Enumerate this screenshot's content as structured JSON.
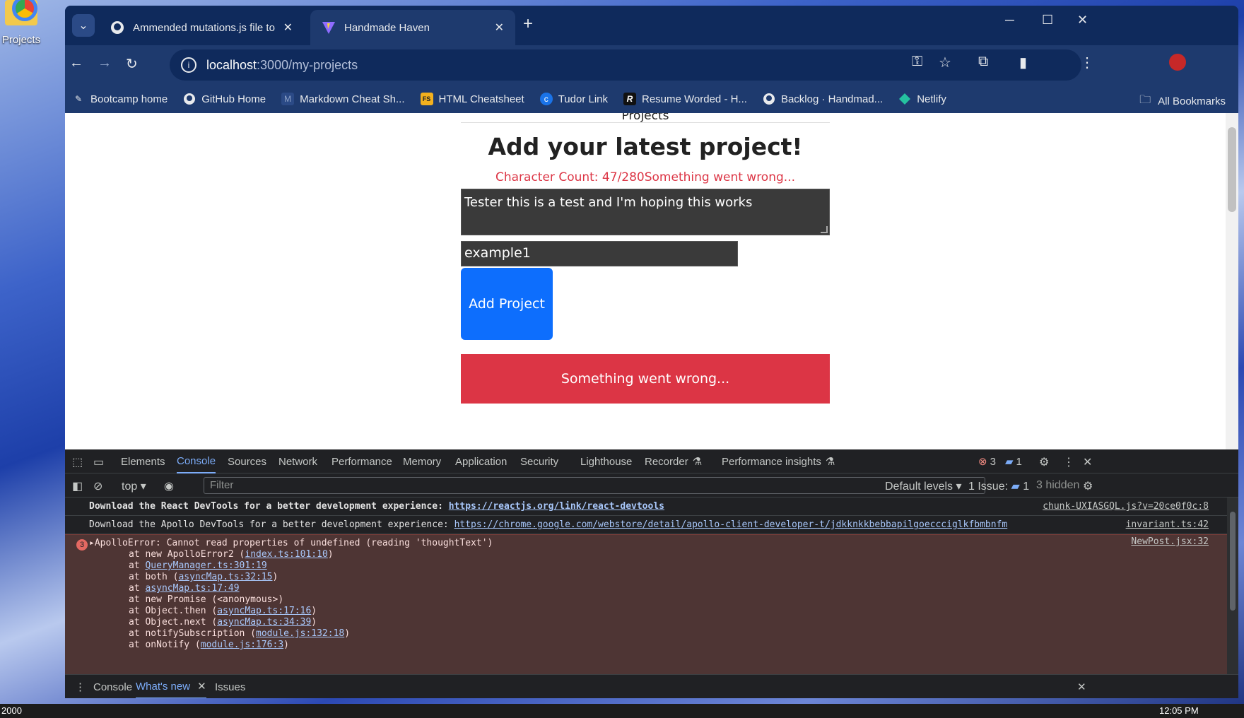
{
  "desktop": {
    "icon_label": "Projects"
  },
  "tabs": [
    {
      "title": "Ammended mutations.js file to",
      "icon": "github-icon"
    },
    {
      "title": "Handmade Haven",
      "icon": "vite-icon"
    }
  ],
  "toolbar": {
    "url_host": "localhost",
    "url_path": ":3000/my-projects"
  },
  "bookmarks": [
    {
      "label": "Bootcamp home",
      "icon": "bootcamp-icon"
    },
    {
      "label": "GitHub Home",
      "icon": "github-icon"
    },
    {
      "label": "Markdown Cheat Sh...",
      "icon": "markdown-icon"
    },
    {
      "label": "HTML Cheatsheet",
      "icon": "fs-icon"
    },
    {
      "label": "Tudor Link",
      "icon": "link-icon"
    },
    {
      "label": "Resume Worded - H...",
      "icon": "resume-icon"
    },
    {
      "label": "Backlog · Handmad...",
      "icon": "github-icon"
    },
    {
      "label": "Netlify",
      "icon": "netlify-icon"
    }
  ],
  "all_bookmarks": "All Bookmarks",
  "page": {
    "nav_label": "Projects",
    "heading": "Add your latest project!",
    "char_count": "Character Count: 47/280Something went wrong...",
    "textarea_value": "Tester this is a test and I'm hoping this works",
    "input_value": "example1",
    "add_button": "Add Project",
    "error_box": "Something went wrong..."
  },
  "devtools": {
    "tabs": [
      "Elements",
      "Console",
      "Sources",
      "Network",
      "Performance",
      "Memory",
      "Application",
      "Security",
      "Lighthouse",
      "Recorder",
      "Performance insights"
    ],
    "active_tab": "Console",
    "error_count": "3",
    "message_count": "1",
    "context": "top",
    "filter_placeholder": "Filter",
    "levels": "Default levels",
    "issues": "1 Issue:",
    "issues_count": "1",
    "hidden": "3 hidden",
    "console": {
      "line1_text": "Download the React DevTools for a better development experience: ",
      "line1_link": "https://reactjs.org/link/react-devtools",
      "line1_src": "chunk-UXIASGQL.js?v=20ce0f0c:8",
      "line2_text": "Download the Apollo DevTools for a better development experience: ",
      "line2_link": "https://chrome.google.com/webstore/detail/apollo-client-developer-t/jdkknkkbebbapilgoeccciglkfbmbnfm",
      "line2_src": "invariant.ts:42",
      "error_badge": "3",
      "error_msg": "ApolloError: Cannot read properties of undefined (reading 'thoughtText')",
      "error_src": "NewPost.jsx:32",
      "stack": [
        {
          "pre": "at new ApolloError2 (",
          "link": "index.ts:101:10",
          "post": ")"
        },
        {
          "pre": "at ",
          "link": "QueryManager.ts:301:19",
          "post": ""
        },
        {
          "pre": "at both (",
          "link": "asyncMap.ts:32:15",
          "post": ")"
        },
        {
          "pre": "at ",
          "link": "asyncMap.ts:17:49",
          "post": ""
        },
        {
          "pre": "at new Promise (<anonymous>)",
          "link": "",
          "post": ""
        },
        {
          "pre": "at Object.then (",
          "link": "asyncMap.ts:17:16",
          "post": ")"
        },
        {
          "pre": "at Object.next (",
          "link": "asyncMap.ts:34:39",
          "post": ")"
        },
        {
          "pre": "at notifySubscription (",
          "link": "module.js:132:18",
          "post": ")"
        },
        {
          "pre": "at onNotify (",
          "link": "module.js:176:3",
          "post": ")"
        }
      ]
    },
    "drawer_tabs": [
      "Console",
      "What's new",
      "Issues"
    ],
    "drawer_active": "What's new"
  },
  "taskbar": {
    "left_text": "2000",
    "time": "12:05 PM"
  }
}
